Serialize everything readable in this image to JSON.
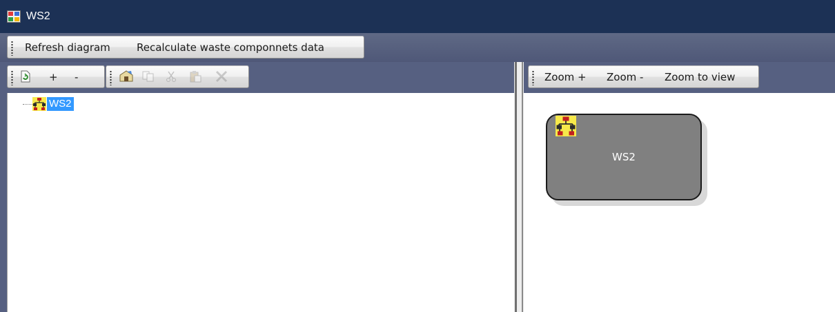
{
  "window": {
    "title": "WS2",
    "icon": "app-window-icon"
  },
  "main_toolbar": {
    "refresh_label": "Refresh diagram",
    "recalc_label": "Recalculate waste componnets data"
  },
  "tree_toolbar": {
    "expand_label": "+",
    "collapse_label": "-",
    "icons": [
      "refresh-icon",
      "properties-icon",
      "copy-icon",
      "cut-icon",
      "paste-icon",
      "delete-icon"
    ]
  },
  "tree": {
    "root_label": "WS2",
    "root_icon": "waste-hierarchy-icon"
  },
  "diagram_toolbar": {
    "zoom_in_label": "Zoom +",
    "zoom_out_label": "Zoom -",
    "zoom_fit_label": "Zoom to view"
  },
  "diagram": {
    "node_label": "WS2",
    "node_icon": "waste-hierarchy-icon"
  },
  "colors": {
    "titlebar": "#1c3155",
    "workspace": "#566081",
    "selection": "#3399ff",
    "node_fill": "#808080"
  }
}
